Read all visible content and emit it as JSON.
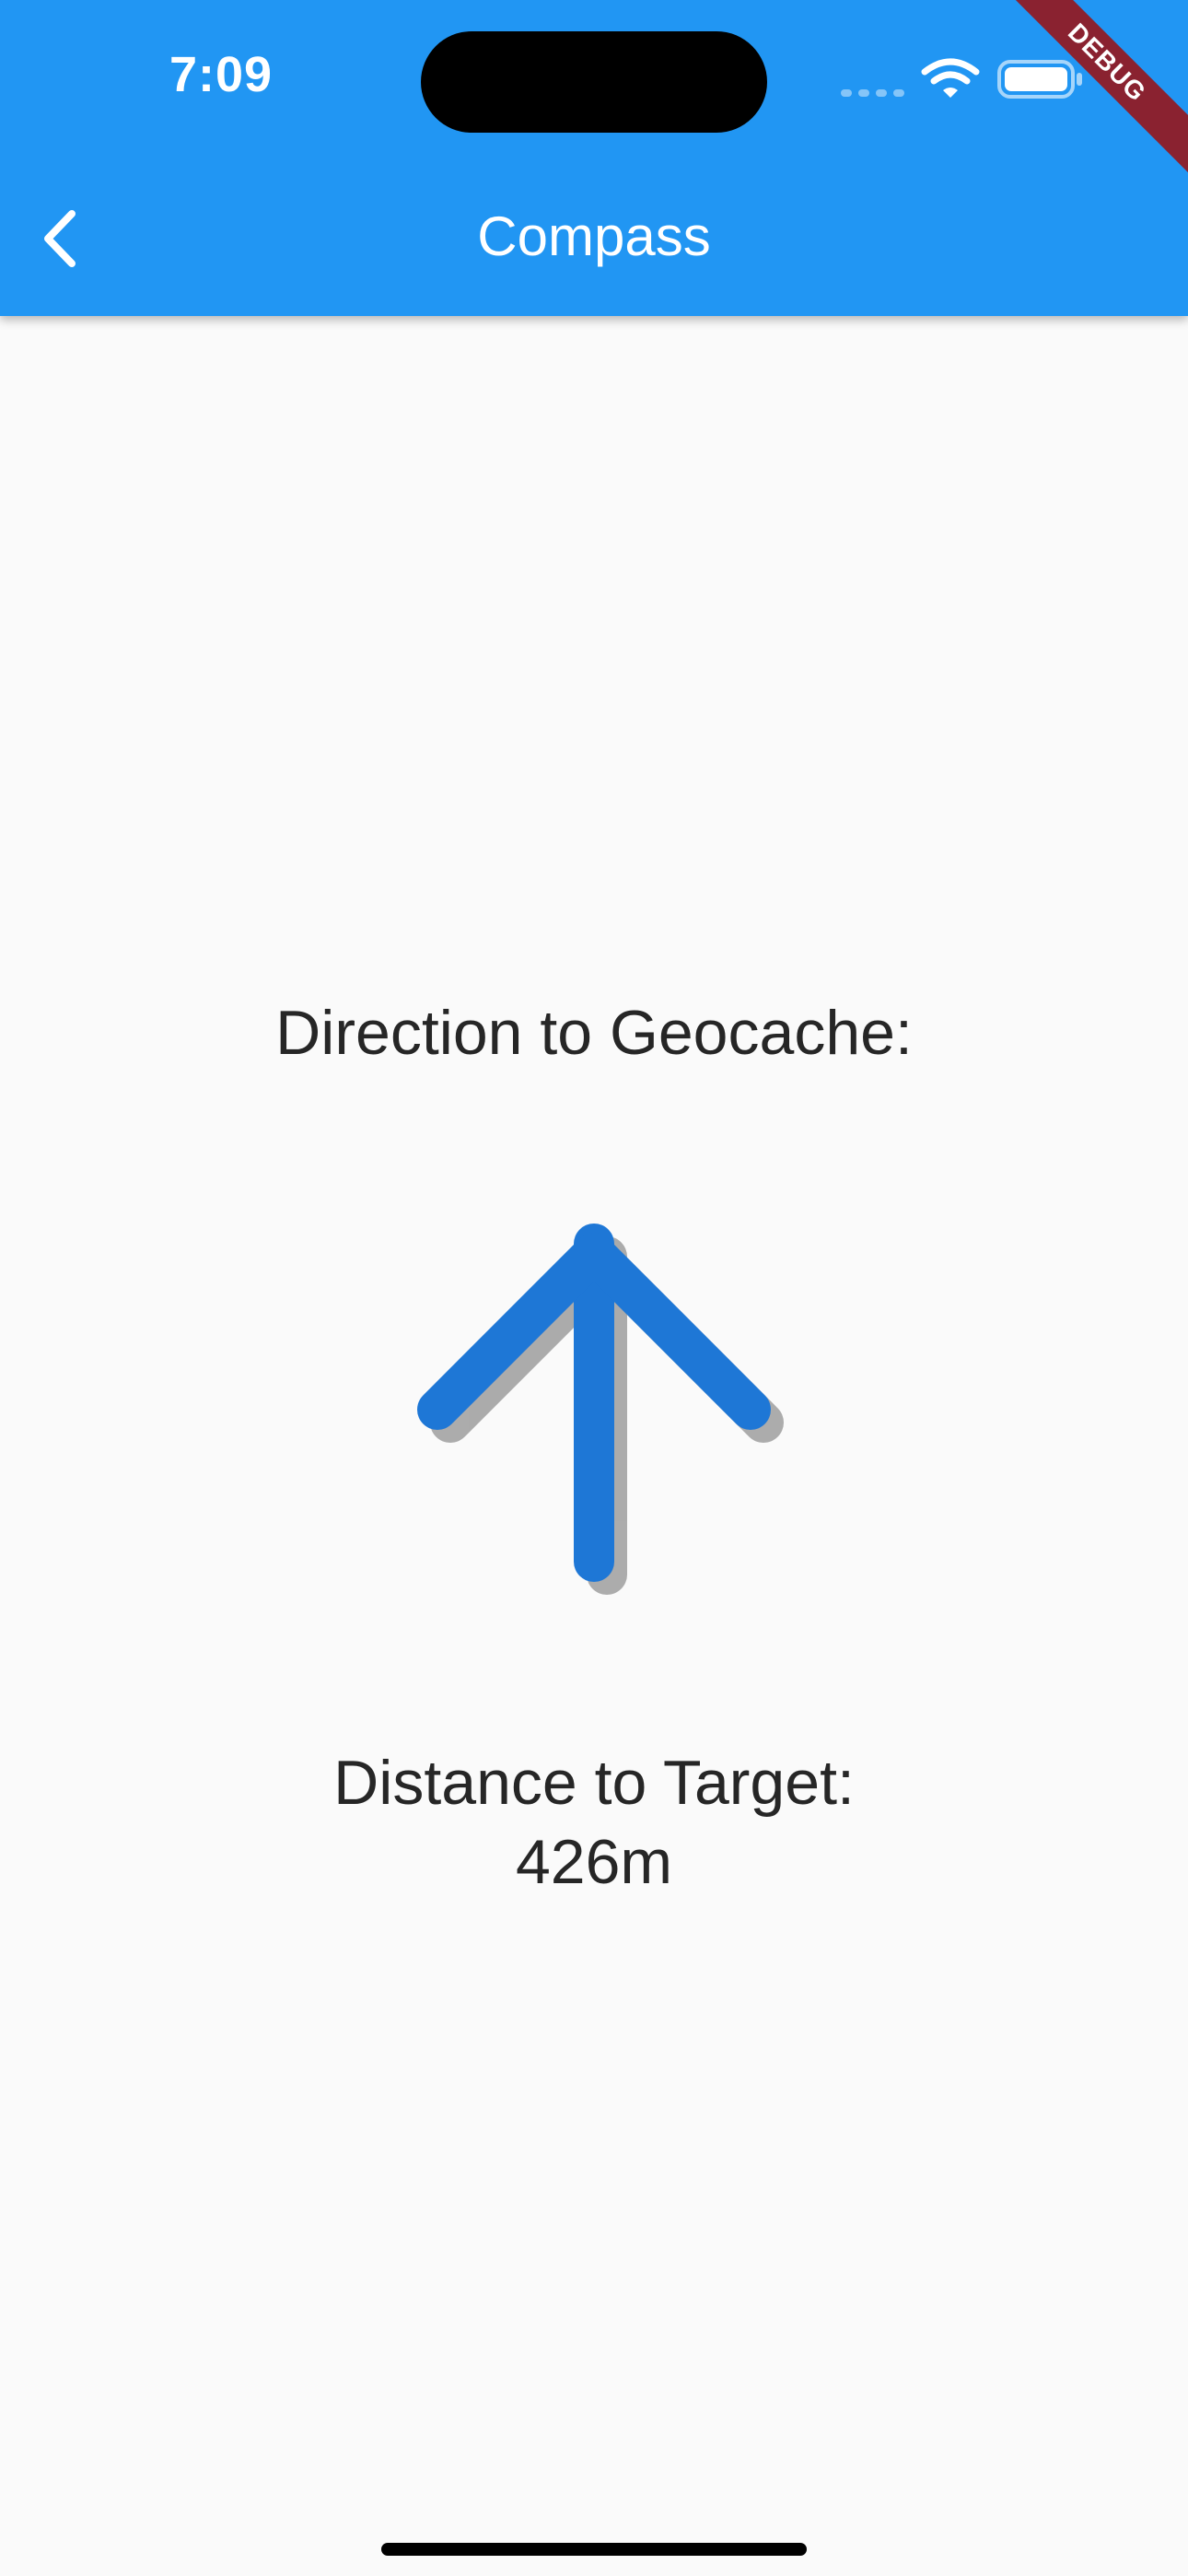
{
  "status_bar": {
    "time": "7:09"
  },
  "app_bar": {
    "title": "Compass",
    "back_icon": "chevron-left-icon",
    "color": "#2196f3",
    "debug_banner": "DEBUG"
  },
  "main": {
    "direction_label": "Direction to Geocache:",
    "direction_icon": "arrow-up-icon",
    "distance_label": "Distance to Target:",
    "distance_value": "426m",
    "arrow_color": "#1e77d6"
  }
}
